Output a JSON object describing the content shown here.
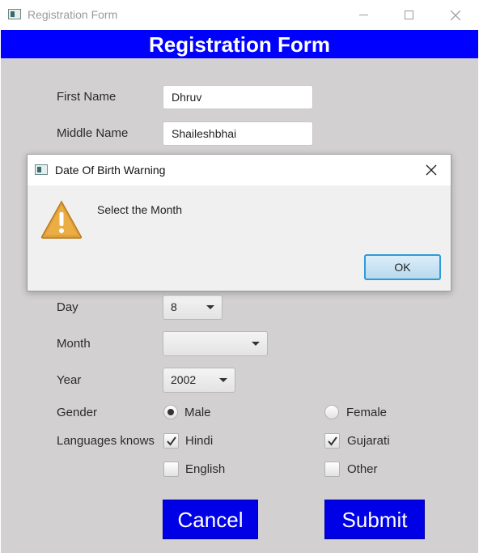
{
  "window": {
    "title": "Registration Form"
  },
  "form": {
    "header": "Registration Form",
    "first_name": {
      "label": "First Name",
      "value": "Dhruv"
    },
    "middle_name": {
      "label": "Middle Name",
      "value": "Shaileshbhai"
    },
    "day": {
      "label": "Day",
      "value": "8"
    },
    "month": {
      "label": "Month",
      "value": ""
    },
    "year": {
      "label": "Year",
      "value": "2002"
    },
    "gender": {
      "label": "Gender",
      "options": [
        {
          "label": "Male",
          "selected": true
        },
        {
          "label": "Female",
          "selected": false
        }
      ]
    },
    "languages": {
      "label": "Languages knows",
      "options": [
        {
          "label": "Hindi",
          "checked": true
        },
        {
          "label": "Gujarati",
          "checked": true
        },
        {
          "label": "English",
          "checked": false
        },
        {
          "label": "Other",
          "checked": false
        }
      ]
    },
    "cancel_label": "Cancel",
    "submit_label": "Submit"
  },
  "dialog": {
    "title": "Date Of Birth Warning",
    "message": "Select the Month",
    "ok_label": "OK",
    "icon": "warning-icon"
  },
  "colors": {
    "header_bg": "#0000ff",
    "button_bg": "#0000e6",
    "form_bg": "#d2d0d1",
    "ok_border": "#2f9ad6"
  }
}
